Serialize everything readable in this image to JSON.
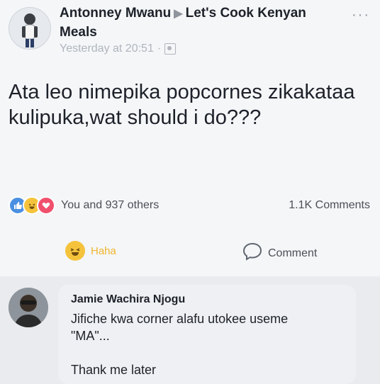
{
  "post": {
    "author": "Antonney Mwanu",
    "group": "Let's Cook Kenyan Meals",
    "timestamp": "Yesterday at 20:51",
    "separator": "·",
    "more_label": "···",
    "text": "Ata leo nimepika popcornes zikakataa kulipuka,wat should i do???",
    "reactions": {
      "summary": "You and 937 others",
      "icons": [
        "like-icon",
        "haha-icon",
        "love-icon"
      ],
      "comments_count": "1.1K Comments"
    },
    "actions": {
      "reaction_label": "Haha",
      "comment_label": "Comment"
    }
  },
  "comment": {
    "author": "Jamie Wachira Njogu",
    "text": "Jifiche kwa corner alafu utokee useme\n\"MA\"...\n\nThank me later"
  },
  "colors": {
    "haha_yellow": "#f5c33b",
    "like_blue": "#4a90e2",
    "love_red": "#f0506e",
    "meta_gray": "#b0b5bd"
  }
}
